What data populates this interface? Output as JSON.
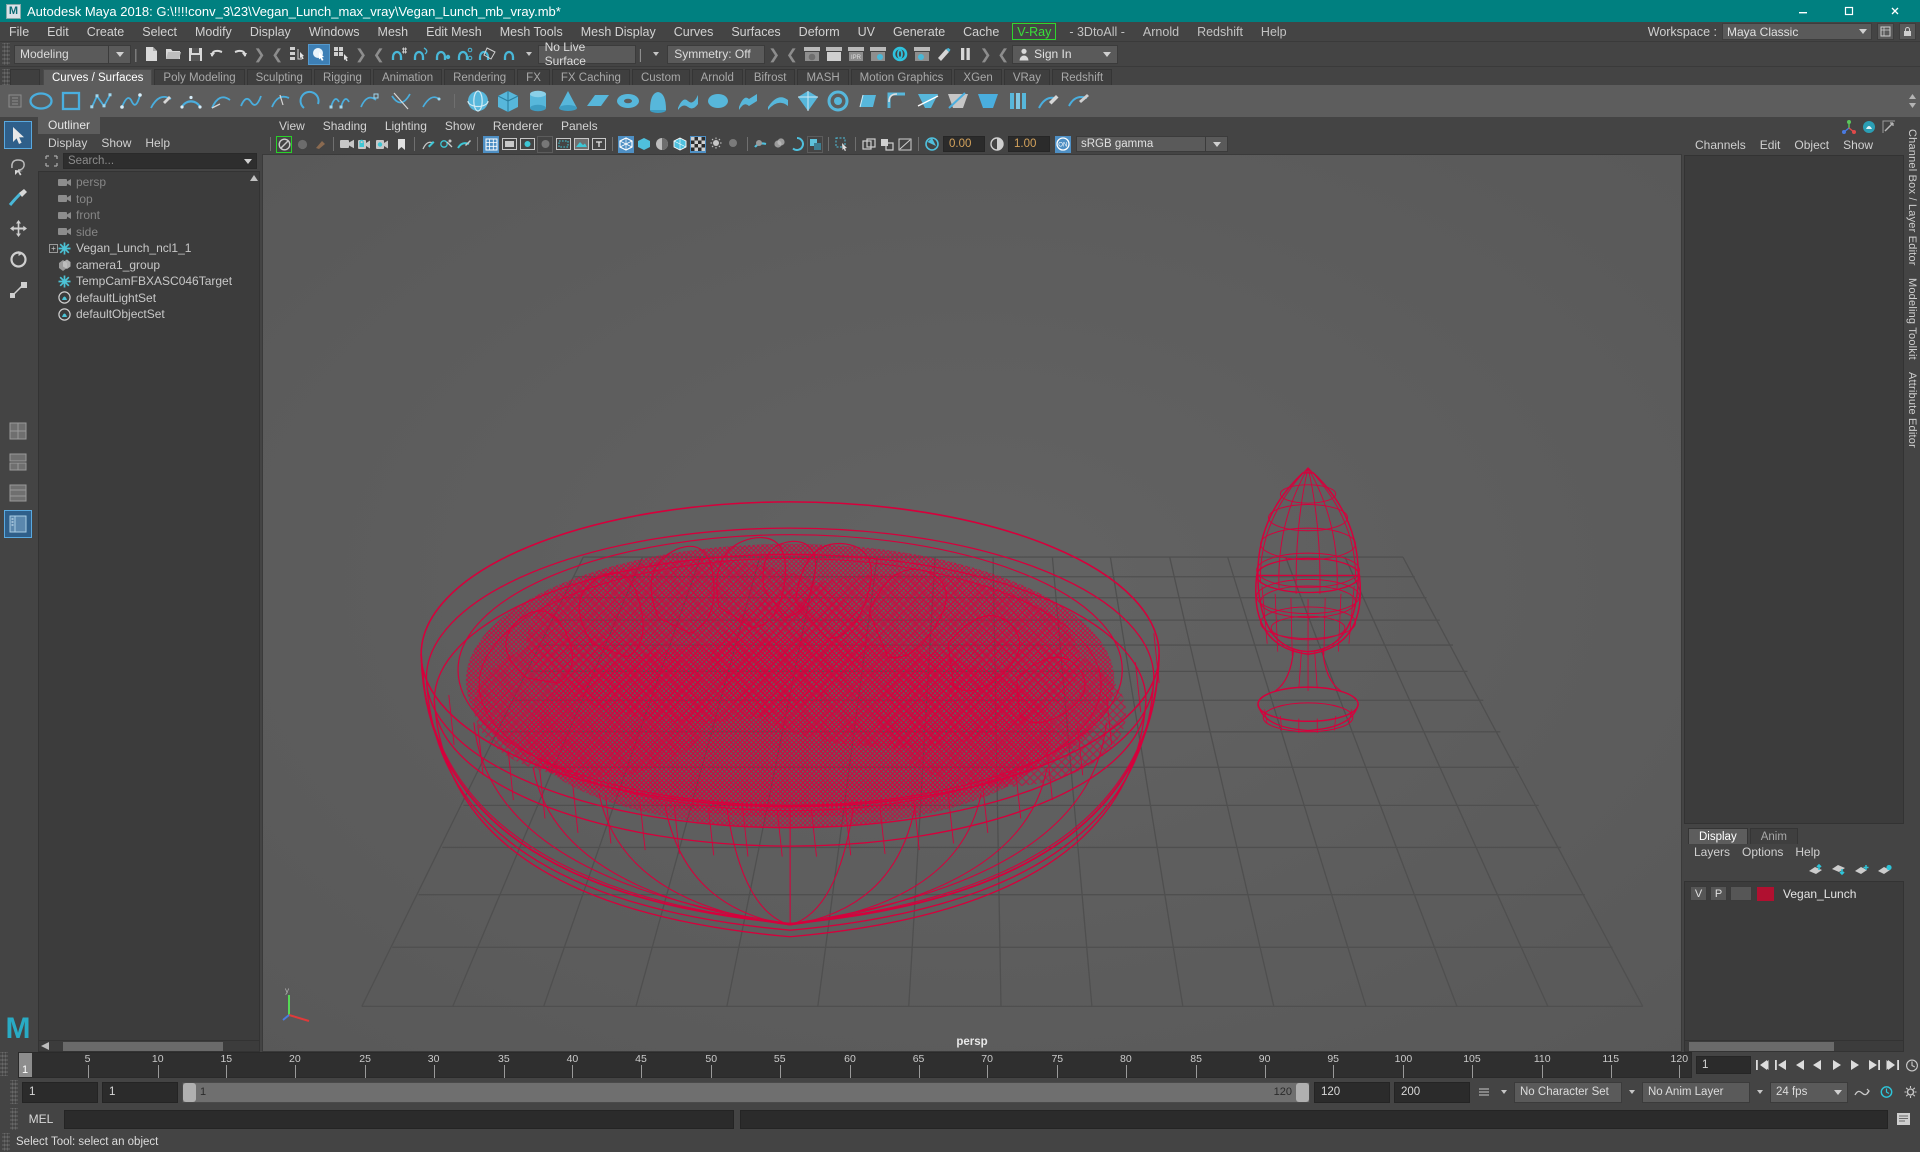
{
  "window": {
    "title": "Autodesk Maya 2018: G:\\!!!!conv_3\\23\\Vegan_Lunch_max_vray\\Vegan_Lunch_mb_vray.mb*",
    "minimize_label": "Minimize",
    "maximize_label": "Maximize",
    "close_label": "Close",
    "titlebar_color": "#008080"
  },
  "menubar": {
    "items": [
      {
        "label": "File"
      },
      {
        "label": "Edit"
      },
      {
        "label": "Create"
      },
      {
        "label": "Select"
      },
      {
        "label": "Modify"
      },
      {
        "label": "Display"
      },
      {
        "label": "Windows"
      },
      {
        "label": "Mesh"
      },
      {
        "label": "Edit Mesh"
      },
      {
        "label": "Mesh Tools"
      },
      {
        "label": "Mesh Display"
      },
      {
        "label": "Curves"
      },
      {
        "label": "Surfaces"
      },
      {
        "label": "Deform"
      },
      {
        "label": "UV"
      },
      {
        "label": "Generate"
      },
      {
        "label": "Cache"
      }
    ],
    "vray_label": "V-Ray",
    "plugin_labels": [
      "- 3DtoAll -",
      "Arnold",
      "Redshift",
      "Help"
    ],
    "workspace_label": "Workspace :",
    "workspace_value": "Maya Classic"
  },
  "statusline": {
    "menuset_value": "Modeling",
    "live_surface_value": "No Live Surface",
    "symmetry_value": "Symmetry: Off",
    "signin_label": "Sign In"
  },
  "shelf": {
    "tabs": [
      {
        "label": "Curves / Surfaces",
        "active": true
      },
      {
        "label": "Poly Modeling",
        "active": false
      },
      {
        "label": "Sculpting",
        "active": false
      },
      {
        "label": "Rigging",
        "active": false
      },
      {
        "label": "Animation",
        "active": false
      },
      {
        "label": "Rendering",
        "active": false
      },
      {
        "label": "FX",
        "active": false
      },
      {
        "label": "FX Caching",
        "active": false
      },
      {
        "label": "Custom",
        "active": false
      },
      {
        "label": "Arnold",
        "active": false
      },
      {
        "label": "Bifrost",
        "active": false
      },
      {
        "label": "MASH",
        "active": false
      },
      {
        "label": "Motion Graphics",
        "active": false
      },
      {
        "label": "XGen",
        "active": false
      },
      {
        "label": "VRay",
        "active": false
      },
      {
        "label": "Redshift",
        "active": false
      }
    ]
  },
  "outliner": {
    "tab_label": "Outliner",
    "menus": [
      "Display",
      "Show",
      "Help"
    ],
    "search_placeholder": "Search...",
    "items": [
      {
        "label": "persp",
        "icon": "camera-icon",
        "dim": true,
        "expander": false
      },
      {
        "label": "top",
        "icon": "camera-icon",
        "dim": true,
        "expander": false
      },
      {
        "label": "front",
        "icon": "camera-icon",
        "dim": true,
        "expander": false
      },
      {
        "label": "side",
        "icon": "camera-icon",
        "dim": true,
        "expander": false
      },
      {
        "label": "Vegan_Lunch_ncl1_1",
        "icon": "transform-icon",
        "dim": false,
        "expander": true
      },
      {
        "label": "camera1_group",
        "icon": "group-icon",
        "dim": false,
        "expander": false
      },
      {
        "label": "TempCamFBXASC046Target",
        "icon": "transform-icon",
        "dim": false,
        "expander": false
      },
      {
        "label": "defaultLightSet",
        "icon": "set-icon",
        "dim": false,
        "expander": false
      },
      {
        "label": "defaultObjectSet",
        "icon": "set-icon",
        "dim": false,
        "expander": false
      }
    ]
  },
  "viewport": {
    "menus": [
      "View",
      "Shading",
      "Lighting",
      "Show",
      "Renderer",
      "Panels"
    ],
    "exposure_value": "0.00",
    "gamma_value": "1.00",
    "color_space": "sRGB gamma",
    "camera_label": "persp",
    "wireframe_color": "#d6003c",
    "background_color": "#5c5c5c",
    "grid_color": "#4e4e4e"
  },
  "channelbox": {
    "menus": [
      "Channels",
      "Edit",
      "Object",
      "Show"
    ],
    "vertical_tabs": [
      "Channel Box / Layer Editor",
      "Modeling Toolkit",
      "Attribute Editor"
    ]
  },
  "layer_editor": {
    "tabs": [
      {
        "label": "Display",
        "active": true
      },
      {
        "label": "Anim",
        "active": false
      }
    ],
    "menus": [
      "Layers",
      "Options",
      "Help"
    ],
    "layers": [
      {
        "visible": "V",
        "playback": "P",
        "shade": "",
        "color": "#b01030",
        "name": "Vegan_Lunch"
      }
    ]
  },
  "timeline": {
    "current_frame": "1",
    "tick_labels": [
      "5",
      "10",
      "15",
      "20",
      "25",
      "30",
      "35",
      "40",
      "45",
      "50",
      "55",
      "60",
      "65",
      "70",
      "75",
      "80",
      "85",
      "90",
      "95",
      "100",
      "105",
      "110",
      "115",
      "120"
    ],
    "field_value": "1",
    "playback_icons": [
      "go-to-start",
      "step-back-key",
      "step-back",
      "play-backwards",
      "play-forwards",
      "step-forward",
      "step-forward-key",
      "go-to-end",
      "sound-toggle"
    ]
  },
  "rangebar": {
    "start_field": "1",
    "anim_start_field": "1",
    "range_start_label": "1",
    "range_end_label": "120",
    "end_field": "120",
    "anim_end_field": "200",
    "character_set": "No Character Set",
    "anim_layer": "No Anim Layer",
    "fps": "24 fps"
  },
  "mel": {
    "label": "MEL",
    "command_value": "",
    "output_value": ""
  },
  "helpline": {
    "text": "Select Tool: select an object"
  }
}
